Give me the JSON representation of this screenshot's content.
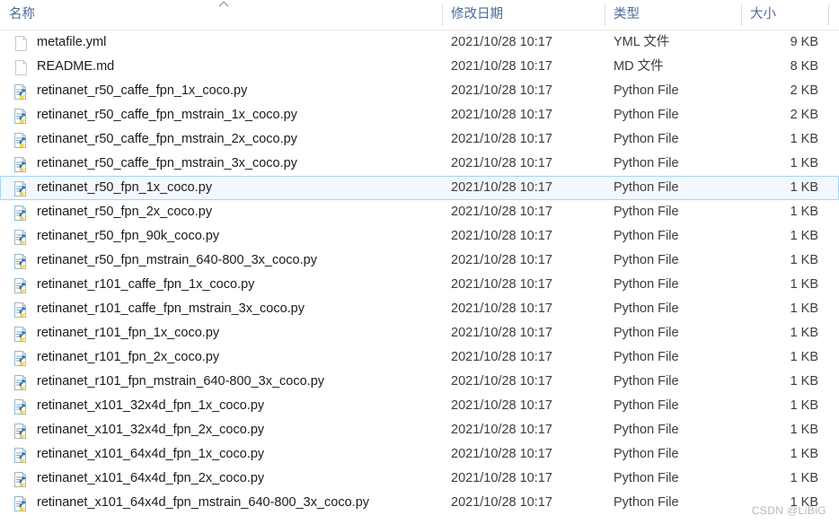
{
  "header": {
    "columns": [
      {
        "key": "name",
        "label": "名称",
        "icon": "sort-ascending-icon"
      },
      {
        "key": "date",
        "label": "修改日期"
      },
      {
        "key": "type",
        "label": "类型"
      },
      {
        "key": "size",
        "label": "大小"
      }
    ],
    "sort_indicator": "^"
  },
  "files": [
    {
      "name": "metafile.yml",
      "date": "2021/10/28 10:17",
      "type": "YML 文件",
      "size": "9 KB",
      "icon": "generic-file-icon",
      "selected": false
    },
    {
      "name": "README.md",
      "date": "2021/10/28 10:17",
      "type": "MD 文件",
      "size": "8 KB",
      "icon": "generic-file-icon",
      "selected": false
    },
    {
      "name": "retinanet_r50_caffe_fpn_1x_coco.py",
      "date": "2021/10/28 10:17",
      "type": "Python File",
      "size": "2 KB",
      "icon": "python-file-icon",
      "selected": false
    },
    {
      "name": "retinanet_r50_caffe_fpn_mstrain_1x_coco.py",
      "date": "2021/10/28 10:17",
      "type": "Python File",
      "size": "2 KB",
      "icon": "python-file-icon",
      "selected": false
    },
    {
      "name": "retinanet_r50_caffe_fpn_mstrain_2x_coco.py",
      "date": "2021/10/28 10:17",
      "type": "Python File",
      "size": "1 KB",
      "icon": "python-file-icon",
      "selected": false
    },
    {
      "name": "retinanet_r50_caffe_fpn_mstrain_3x_coco.py",
      "date": "2021/10/28 10:17",
      "type": "Python File",
      "size": "1 KB",
      "icon": "python-file-icon",
      "selected": false
    },
    {
      "name": "retinanet_r50_fpn_1x_coco.py",
      "date": "2021/10/28 10:17",
      "type": "Python File",
      "size": "1 KB",
      "icon": "python-file-icon",
      "selected": true
    },
    {
      "name": "retinanet_r50_fpn_2x_coco.py",
      "date": "2021/10/28 10:17",
      "type": "Python File",
      "size": "1 KB",
      "icon": "python-file-icon",
      "selected": false
    },
    {
      "name": "retinanet_r50_fpn_90k_coco.py",
      "date": "2021/10/28 10:17",
      "type": "Python File",
      "size": "1 KB",
      "icon": "python-file-icon",
      "selected": false
    },
    {
      "name": "retinanet_r50_fpn_mstrain_640-800_3x_coco.py",
      "date": "2021/10/28 10:17",
      "type": "Python File",
      "size": "1 KB",
      "icon": "python-file-icon",
      "selected": false
    },
    {
      "name": "retinanet_r101_caffe_fpn_1x_coco.py",
      "date": "2021/10/28 10:17",
      "type": "Python File",
      "size": "1 KB",
      "icon": "python-file-icon",
      "selected": false
    },
    {
      "name": "retinanet_r101_caffe_fpn_mstrain_3x_coco.py",
      "date": "2021/10/28 10:17",
      "type": "Python File",
      "size": "1 KB",
      "icon": "python-file-icon",
      "selected": false
    },
    {
      "name": "retinanet_r101_fpn_1x_coco.py",
      "date": "2021/10/28 10:17",
      "type": "Python File",
      "size": "1 KB",
      "icon": "python-file-icon",
      "selected": false
    },
    {
      "name": "retinanet_r101_fpn_2x_coco.py",
      "date": "2021/10/28 10:17",
      "type": "Python File",
      "size": "1 KB",
      "icon": "python-file-icon",
      "selected": false
    },
    {
      "name": "retinanet_r101_fpn_mstrain_640-800_3x_coco.py",
      "date": "2021/10/28 10:17",
      "type": "Python File",
      "size": "1 KB",
      "icon": "python-file-icon",
      "selected": false
    },
    {
      "name": "retinanet_x101_32x4d_fpn_1x_coco.py",
      "date": "2021/10/28 10:17",
      "type": "Python File",
      "size": "1 KB",
      "icon": "python-file-icon",
      "selected": false
    },
    {
      "name": "retinanet_x101_32x4d_fpn_2x_coco.py",
      "date": "2021/10/28 10:17",
      "type": "Python File",
      "size": "1 KB",
      "icon": "python-file-icon",
      "selected": false
    },
    {
      "name": "retinanet_x101_64x4d_fpn_1x_coco.py",
      "date": "2021/10/28 10:17",
      "type": "Python File",
      "size": "1 KB",
      "icon": "python-file-icon",
      "selected": false
    },
    {
      "name": "retinanet_x101_64x4d_fpn_2x_coco.py",
      "date": "2021/10/28 10:17",
      "type": "Python File",
      "size": "1 KB",
      "icon": "python-file-icon",
      "selected": false
    },
    {
      "name": "retinanet_x101_64x4d_fpn_mstrain_640-800_3x_coco.py",
      "date": "2021/10/28 10:17",
      "type": "Python File",
      "size": "1 KB",
      "icon": "python-file-icon",
      "selected": false
    }
  ],
  "watermark": {
    "text": "CSDN @LiBiG"
  },
  "colors": {
    "header_text": "#4a6b9a",
    "row_text": "#1b1b1b",
    "selection_border": "#a8d5f2",
    "selection_fill": "#f2f8fd",
    "divider": "#dedede",
    "watermark": "#b9b9b9"
  }
}
